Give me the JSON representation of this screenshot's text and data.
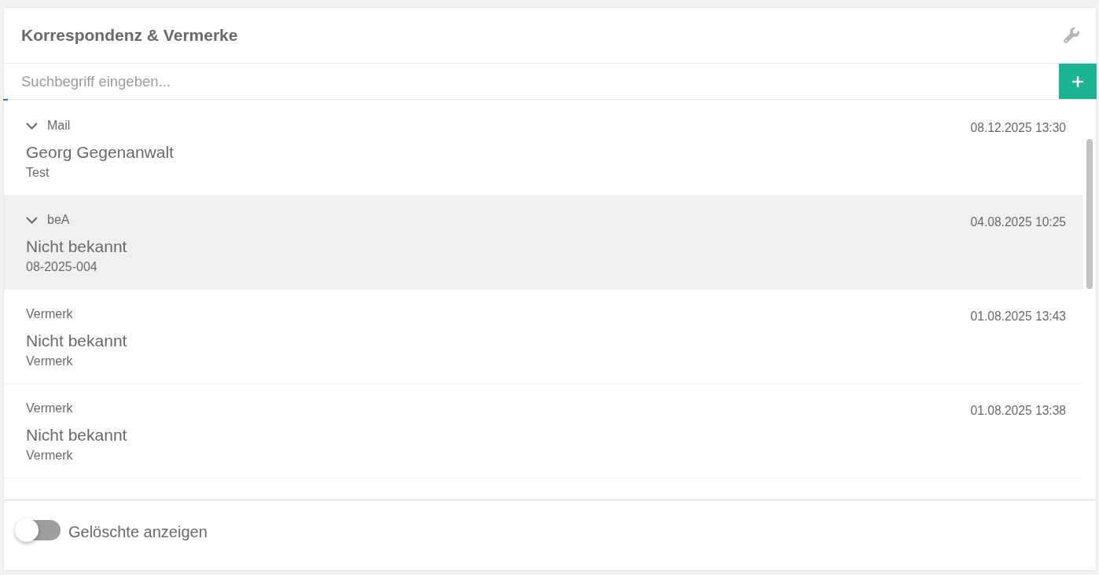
{
  "panel": {
    "title": "Korrespondenz & Vermerke"
  },
  "search": {
    "placeholder": "Suchbegriff eingeben..."
  },
  "entries": [
    {
      "type_label": "Mail",
      "expandable": true,
      "date": "08.12.2025 13:30",
      "name": "Georg Gegenanwalt",
      "subject": "Test",
      "selected": false
    },
    {
      "type_label": "beA",
      "expandable": true,
      "date": "04.08.2025 10:25",
      "name": "Nicht bekannt",
      "subject": "08-2025-004",
      "selected": true
    },
    {
      "type_label": "Vermerk",
      "expandable": false,
      "date": "01.08.2025 13:43",
      "name": "Nicht bekannt",
      "subject": "Vermerk",
      "selected": false
    },
    {
      "type_label": "Vermerk",
      "expandable": false,
      "date": "01.08.2025 13:38",
      "name": "Nicht bekannt",
      "subject": "Vermerk",
      "selected": false
    }
  ],
  "show_deleted": {
    "label": "Gelöschte anzeigen",
    "on": false
  }
}
